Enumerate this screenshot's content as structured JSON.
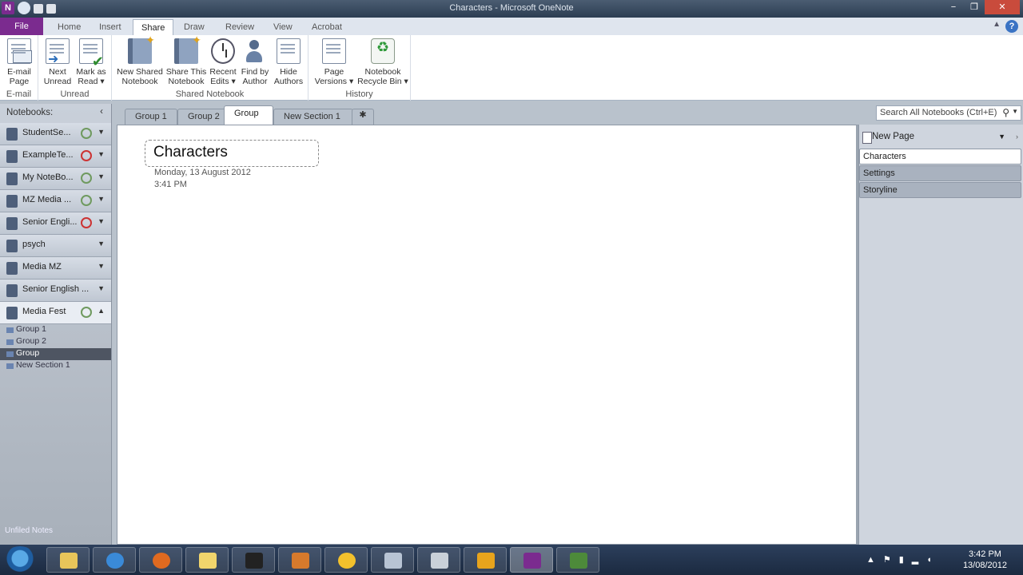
{
  "window": {
    "title": "Characters - Microsoft OneNote",
    "buttons": [
      "−",
      "❐",
      "✕"
    ]
  },
  "ribbon_tabs": [
    "File",
    "Home",
    "Insert",
    "Share",
    "Draw",
    "Review",
    "View",
    "Acrobat"
  ],
  "ribbon_groups": [
    {
      "label": "E-mail",
      "buttons": [
        {
          "line1": "E-mail",
          "line2": "Page"
        }
      ]
    },
    {
      "label": "Unread",
      "buttons": [
        {
          "line1": "Next",
          "line2": "Unread"
        },
        {
          "line1": "Mark as",
          "line2": "Read ▾"
        }
      ]
    },
    {
      "label": "Shared Notebook",
      "buttons": [
        {
          "line1": "New Shared",
          "line2": "Notebook"
        },
        {
          "line1": "Share This",
          "line2": "Notebook"
        },
        {
          "line1": "Recent",
          "line2": "Edits ▾"
        },
        {
          "line1": "Find by",
          "line2": "Author"
        },
        {
          "line1": "Hide",
          "line2": "Authors"
        }
      ]
    },
    {
      "label": "History",
      "buttons": [
        {
          "line1": "Page",
          "line2": "Versions ▾"
        },
        {
          "line1": "Notebook",
          "line2": "Recycle Bin ▾"
        }
      ]
    }
  ],
  "search": {
    "placeholder": "Search All Notebooks (Ctrl+E)"
  },
  "notebooks_header": "Notebooks:",
  "notebooks": [
    {
      "name": "StudentSe...",
      "sync": "ok"
    },
    {
      "name": "ExampleTe...",
      "sync": "error"
    },
    {
      "name": "My NoteBo...",
      "sync": "ok"
    },
    {
      "name": "MZ Media ...",
      "sync": "ok"
    },
    {
      "name": "Senior Engli...",
      "sync": "error"
    },
    {
      "name": "psych",
      "sync": "none"
    },
    {
      "name": "Media MZ",
      "sync": "none"
    },
    {
      "name": "Senior English ...",
      "sync": "none"
    },
    {
      "name": "Media Fest",
      "sync": "ok"
    }
  ],
  "open_notebook_sections": [
    "Group 1",
    "Group 2",
    "Group",
    "New Section 1"
  ],
  "notebooks_footer": "Unfiled Notes",
  "section_tabs": [
    "Group 1",
    "Group 2",
    "Group",
    "New Section 1",
    "✱"
  ],
  "page": {
    "title": "Characters",
    "date": "Monday, 13 August 2012",
    "time": "3:41 PM"
  },
  "pages_panel": {
    "new_page": "New Page",
    "pages": [
      "Characters",
      "Settings",
      "Storyline"
    ]
  },
  "taskbar": {
    "time": "3:42 PM",
    "date": "13/08/2012"
  }
}
